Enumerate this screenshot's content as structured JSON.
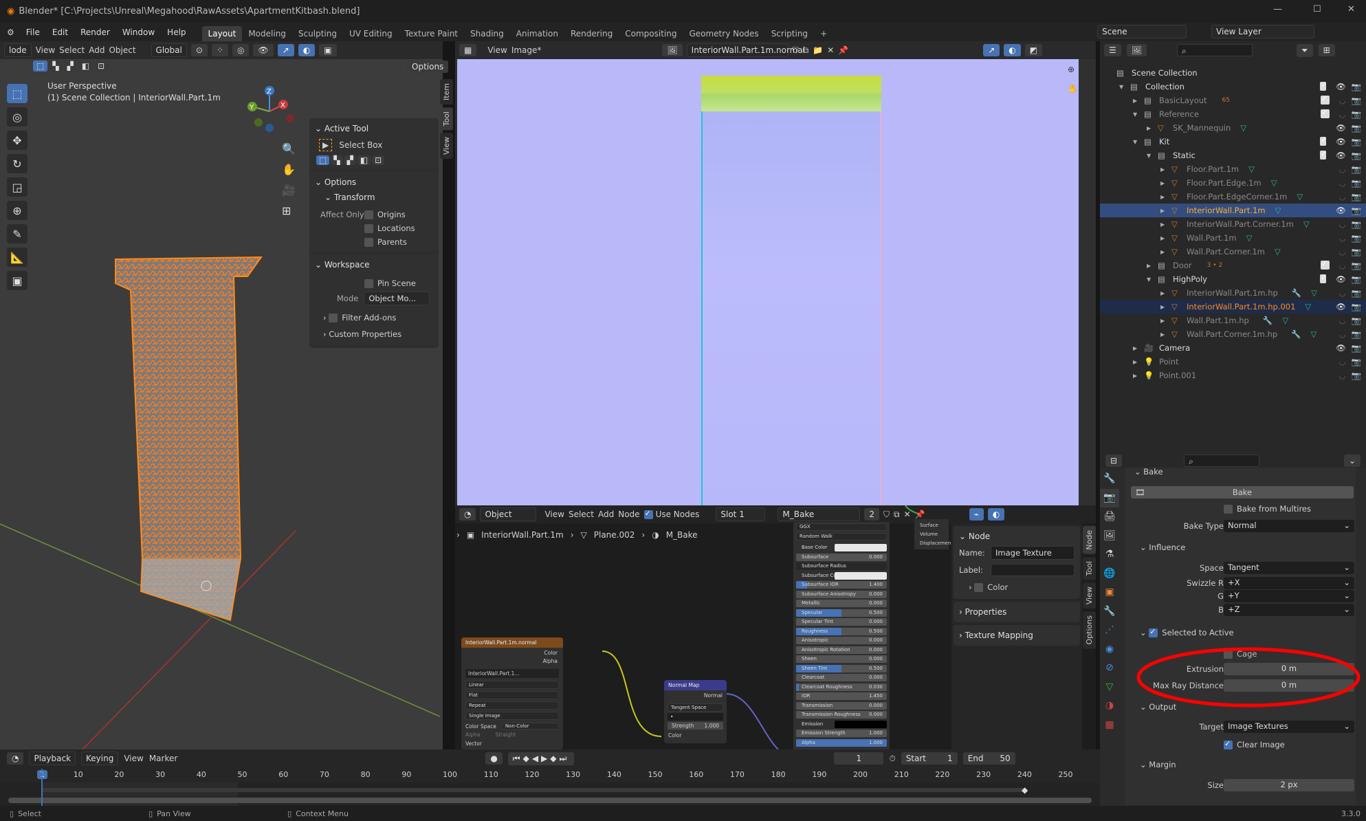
{
  "title": "Blender* [C:\\Projects\\Unreal\\Megahood\\RawAssets\\ApartmentKitbash.blend]",
  "menu": [
    "File",
    "Edit",
    "Render",
    "Window",
    "Help"
  ],
  "workspaces": [
    "Layout",
    "Modeling",
    "Sculpting",
    "UV Editing",
    "Texture Paint",
    "Shading",
    "Animation",
    "Rendering",
    "Compositing",
    "Geometry Nodes",
    "Scripting",
    "+"
  ],
  "active_workspace": "Layout",
  "scene": "Scene",
  "view_layer": "View Layer",
  "viewport": {
    "mode": "lode",
    "menus": [
      "View",
      "Select",
      "Add",
      "Object"
    ],
    "orientation": "Global",
    "options": "Options",
    "perspective": "User Perspective",
    "collection_info": "(1) Scene Collection | InteriorWall.Part.1m",
    "gizmo": {
      "x": "X",
      "y": "Y",
      "z": "Z"
    }
  },
  "npanel": {
    "active_tool": "Active Tool",
    "tool_name": "Select Box",
    "options": "Options",
    "transform": "Transform",
    "affect_only": "Affect Only",
    "origins": "Origins",
    "locations": "Locations",
    "parents": "Parents",
    "workspace": "Workspace",
    "pin_scene": "Pin Scene",
    "mode_label": "Mode",
    "mode_value": "Object Mo...",
    "filter_addons": "Filter Add-ons",
    "custom_props": "Custom Properties",
    "tabs": [
      "Item",
      "Tool",
      "View"
    ]
  },
  "image_editor": {
    "menus": [
      "View",
      "Image*"
    ],
    "image_name": "InteriorWall.Part.1m.normal"
  },
  "node_editor": {
    "object_mode": "Object",
    "menus": [
      "View",
      "Select",
      "Add",
      "Node"
    ],
    "use_nodes": "Use Nodes",
    "slot": "Slot 1",
    "material": "M_Bake",
    "users": "2",
    "breadcrumb": [
      "InteriorWall.Part.1m",
      "Plane.002",
      "M_Bake"
    ],
    "bsdf": {
      "dist": "GGX",
      "sss": "Random Walk",
      "outputs": [
        "Surface",
        "Volume",
        "Displacemen"
      ],
      "rows": [
        {
          "label": "Base Color",
          "type": "color",
          "color": "#e8e8e8"
        },
        {
          "label": "Subsurface",
          "value": "0.000",
          "fill": 0
        },
        {
          "label": "Subsurface Radius",
          "type": "dd"
        },
        {
          "label": "Subsurface Colo",
          "type": "color",
          "color": "#e8e8e8"
        },
        {
          "label": "Subsurface IOR",
          "value": "1.400",
          "fill": 0.12
        },
        {
          "label": "Subsurface Anisotropy",
          "value": "0.000",
          "fill": 0
        },
        {
          "label": "Metallic",
          "value": "0.000",
          "fill": 0
        },
        {
          "label": "Specular",
          "value": "0.500",
          "fill": 0.5
        },
        {
          "label": "Specular Tint",
          "value": "0.000",
          "fill": 0
        },
        {
          "label": "Roughness",
          "value": "0.500",
          "fill": 0.5
        },
        {
          "label": "Anisotropic",
          "value": "0.000",
          "fill": 0
        },
        {
          "label": "Anisotropic Rotation",
          "value": "0.000",
          "fill": 0
        },
        {
          "label": "Sheen",
          "value": "0.000",
          "fill": 0
        },
        {
          "label": "Sheen Tint",
          "value": "0.500",
          "fill": 0.5
        },
        {
          "label": "Clearcoat",
          "value": "0.000",
          "fill": 0
        },
        {
          "label": "Clearcoat Roughness",
          "value": "0.030",
          "fill": 0.03
        },
        {
          "label": "IOR",
          "value": "1.450",
          "fill": 0
        },
        {
          "label": "Transmission",
          "value": "0.000",
          "fill": 0
        },
        {
          "label": "Transmission Roughness",
          "value": "0.000",
          "fill": 0
        },
        {
          "label": "Emission",
          "type": "color",
          "color": "#000000"
        },
        {
          "label": "Emission Strength",
          "value": "1.000",
          "fill": 0
        },
        {
          "label": "Alpha",
          "value": "1.000",
          "fill": 1
        }
      ]
    },
    "image_node": {
      "title": "InteriorWall.Part.1m.normal",
      "out_color": "Color",
      "out_alpha": "Alpha",
      "image": "InteriorWall.Part.1...",
      "interp": "Linear",
      "proj": "Flat",
      "ext": "Repeat",
      "source": "Single Image",
      "cs_label": "Color Space",
      "cs_value": "Non-Color",
      "alpha_label": "Alpha",
      "alpha_value": "Straight",
      "vector": "Vector"
    },
    "normal_node": {
      "title": "Normal Map",
      "out": "Normal",
      "space": "Tangent Space",
      "uv": "•",
      "strength_label": "Strength",
      "strength": "1.000",
      "in_color": "Color"
    },
    "side": {
      "node": "Node",
      "name_label": "Name:",
      "name_value": "Image Texture",
      "label_label": "Label:",
      "color": "Color",
      "properties": "Properties",
      "texture_mapping": "Texture Mapping",
      "tabs": [
        "Node",
        "Tool",
        "View",
        "Options"
      ]
    }
  },
  "outliner": {
    "rows": [
      {
        "name": "Scene Collection",
        "lvl": 0,
        "kind": "scene"
      },
      {
        "name": "Collection",
        "lvl": 1,
        "kind": "coll",
        "exp": "open",
        "check": true,
        "eye": true
      },
      {
        "name": "BasicLayout",
        "lvl": 2,
        "kind": "coll",
        "exp": "closed",
        "check": true,
        "eye": false,
        "badge": "65",
        "dim": true
      },
      {
        "name": "Reference",
        "lvl": 2,
        "kind": "coll",
        "exp": "open",
        "check": true,
        "eye": false,
        "dim": true
      },
      {
        "name": "SK_Mannequin",
        "lvl": 3,
        "kind": "mesh",
        "exp": "closed",
        "eye": true,
        "dim": true
      },
      {
        "name": "Kit",
        "lvl": 2,
        "kind": "coll",
        "exp": "open",
        "check": true,
        "eye": true
      },
      {
        "name": "Static",
        "lvl": 3,
        "kind": "coll",
        "exp": "open",
        "check": true,
        "eye": true
      },
      {
        "name": "Floor.Part.1m",
        "lvl": 4,
        "kind": "mesh",
        "exp": "closed",
        "eye": false,
        "dim": true
      },
      {
        "name": "Floor.Part.Edge.1m",
        "lvl": 4,
        "kind": "mesh",
        "exp": "closed",
        "eye": false,
        "dim": true
      },
      {
        "name": "Floor.Part.EdgeCorner.1m",
        "lvl": 4,
        "kind": "mesh",
        "exp": "closed",
        "eye": false,
        "dim": true
      },
      {
        "name": "InteriorWall.Part.1m",
        "lvl": 4,
        "kind": "mesh",
        "exp": "closed",
        "eye": true,
        "sel": "active"
      },
      {
        "name": "InteriorWall.Part.Corner.1m",
        "lvl": 4,
        "kind": "mesh",
        "exp": "closed",
        "eye": false,
        "dim": true
      },
      {
        "name": "Wall.Part.1m",
        "lvl": 4,
        "kind": "mesh",
        "exp": "closed",
        "eye": false,
        "dim": true
      },
      {
        "name": "Wall.Part.Corner.1m",
        "lvl": 4,
        "kind": "mesh",
        "exp": "closed",
        "eye": false,
        "dim": true
      },
      {
        "name": "Door",
        "lvl": 3,
        "kind": "coll",
        "exp": "closed",
        "check": true,
        "eye": false,
        "badge": "3 • 2",
        "dim": true
      },
      {
        "name": "HighPoly",
        "lvl": 3,
        "kind": "coll",
        "exp": "open",
        "check": true,
        "eye": true
      },
      {
        "name": "InteriorWall.Part.1m.hp",
        "lvl": 4,
        "kind": "mesh",
        "exp": "closed",
        "eye": false,
        "dim": true,
        "mod": true
      },
      {
        "name": "InteriorWall.Part.1m.hp.001",
        "lvl": 4,
        "kind": "mesh",
        "exp": "closed",
        "eye": true,
        "sel": "selected"
      },
      {
        "name": "Wall.Part.1m.hp",
        "lvl": 4,
        "kind": "mesh",
        "exp": "closed",
        "eye": false,
        "dim": true,
        "mod": true
      },
      {
        "name": "Wall.Part.Corner.1m.hp",
        "lvl": 4,
        "kind": "mesh",
        "exp": "closed",
        "eye": false,
        "dim": true,
        "mod": true
      },
      {
        "name": "Camera",
        "lvl": 2,
        "kind": "camera",
        "exp": "closed",
        "eye": true
      },
      {
        "name": "Point",
        "lvl": 2,
        "kind": "light",
        "exp": "closed",
        "eye": false,
        "dim": true
      },
      {
        "name": "Point.001",
        "lvl": 2,
        "kind": "light",
        "exp": "closed",
        "eye": false,
        "dim": true
      }
    ]
  },
  "properties": {
    "bake_header": "Bake",
    "bake_button": "Bake",
    "bake_multires": "Bake from Multires",
    "bake_type_label": "Bake Type",
    "bake_type": "Normal",
    "influence": "Influence",
    "space_label": "Space",
    "space": "Tangent",
    "swz_r_label": "Swizzle R",
    "swz_r": "+X",
    "swz_g_label": "G",
    "swz_g": "+Y",
    "swz_b_label": "B",
    "swz_b": "+Z",
    "selected_to_active": "Selected to Active",
    "cage": "Cage",
    "extrusion_label": "Extrusion",
    "extrusion": "0 m",
    "max_ray_label": "Max Ray Distance",
    "max_ray": "0 m",
    "output": "Output",
    "target_label": "Target",
    "target": "Image Textures",
    "clear_image": "Clear Image",
    "margin": "Margin",
    "size_label": "Size",
    "size": "2 px",
    "version": "3.3.0"
  },
  "timeline": {
    "menus": [
      "Playback",
      "Keying",
      "View",
      "Marker"
    ],
    "current": "1",
    "start_label": "Start",
    "start": "1",
    "end_label": "End",
    "end": "50",
    "ticks": [
      "1",
      "10",
      "20",
      "30",
      "40",
      "50",
      "60",
      "70",
      "80",
      "90",
      "100",
      "110",
      "120",
      "130",
      "140",
      "150",
      "160",
      "170",
      "180",
      "190",
      "200",
      "210",
      "220",
      "230",
      "240",
      "250"
    ]
  },
  "status": {
    "select": "Select",
    "pan": "Pan View",
    "context": "Context Menu"
  },
  "colors": {
    "accent": "#4772b3",
    "selection_orange": "#ff8c1a",
    "annotation": "#ff0000"
  }
}
